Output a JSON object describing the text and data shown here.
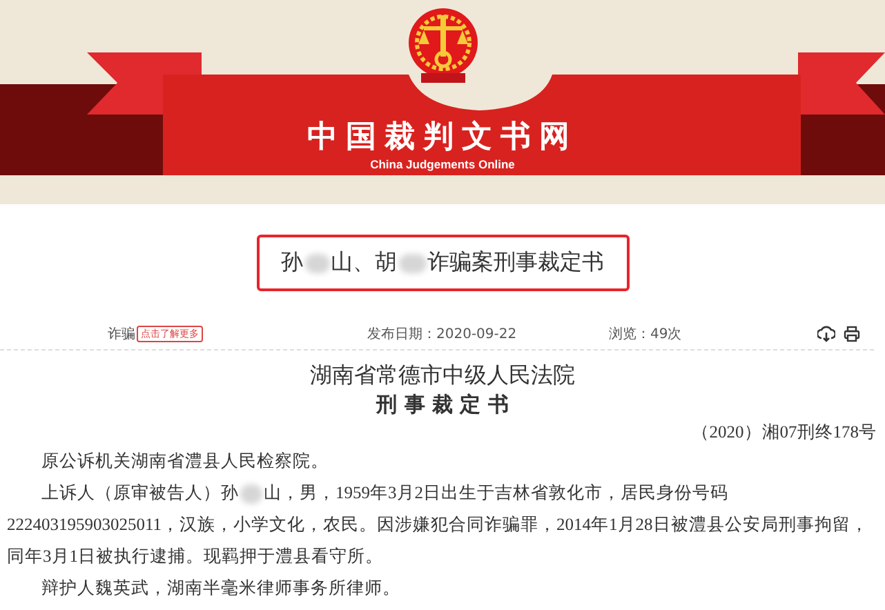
{
  "header": {
    "site_title": "中国裁判文书网",
    "site_subtitle": "China Judgements Online"
  },
  "document": {
    "title_parts": [
      "孙",
      "山、胡",
      "诈骗案刑事裁定书"
    ],
    "tag": "诈骗",
    "tag_link": "点击了解更多",
    "publish_date": "发布日期：2020-09-22",
    "views": "浏览：49次",
    "court": "湖南省常德市中级人民法院",
    "doc_type": "刑 事 裁 定 书",
    "case_number": "（2020）湘07刑终178号",
    "paragraphs": [
      {
        "parts": [
          "原公诉机关湖南省澧县人民检察院。"
        ]
      },
      {
        "parts": [
          "上诉人（原审被告人）孙",
          "山，男，1959年3月2日出生于吉林省敦化市，居民身份号码222403195903025011，汉族，小学文化，农民。因涉嫌犯合同诈骗罪，2014年1月28日被澧县公安局刑事拘留，同年3月1日被执行逮捕。现羁押于澧县看守所。"
        ]
      },
      {
        "parts": [
          "辩护人魏英武，湖南半毫米律师事务所律师。"
        ]
      }
    ]
  }
}
